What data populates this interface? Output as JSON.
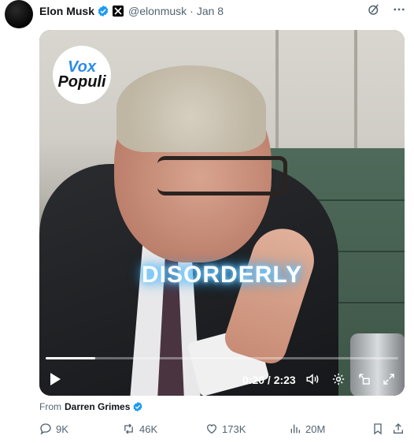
{
  "post": {
    "author_name": "Elon Musk",
    "handle": "@elonmusk",
    "separator": "·",
    "date": "Jan 8"
  },
  "video": {
    "logo_line1": "Vox",
    "logo_line2": "Populi",
    "caption": "DISORDERLY",
    "time_display": "0:20 / 2:23",
    "progress": 0.14
  },
  "source": {
    "prefix": "From",
    "name": "Darren Grimes"
  },
  "actions": {
    "replies": "9K",
    "reposts": "46K",
    "likes": "173K",
    "views": "20M"
  },
  "colors": {
    "verified": "#1d9bf0",
    "muted": "#536471",
    "caption_glow": "#4fb8ff",
    "logo_accent": "#2b8be8"
  }
}
